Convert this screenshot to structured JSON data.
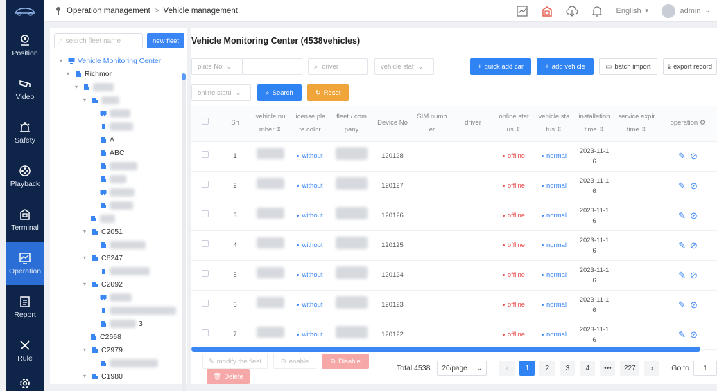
{
  "sidebar": {
    "items": [
      {
        "label": "Position",
        "icon": "position-icon"
      },
      {
        "label": "Video",
        "icon": "video-icon"
      },
      {
        "label": "Safety",
        "icon": "safety-icon"
      },
      {
        "label": "Playback",
        "icon": "playback-icon"
      },
      {
        "label": "Terminal",
        "icon": "terminal-icon"
      },
      {
        "label": "Operation",
        "icon": "operation-icon",
        "active": true
      },
      {
        "label": "Report",
        "icon": "report-icon"
      },
      {
        "label": "Rule",
        "icon": "rule-icon"
      }
    ]
  },
  "topbar": {
    "crumb_root": "Operation management",
    "crumb_sep": ">",
    "crumb_current": "Vehicle management",
    "language": "English",
    "user": "admin"
  },
  "tree": {
    "search_placeholder": "search fleet name",
    "new_fleet": "new fleet",
    "root": "Vehicle Monitoring Center",
    "richmor": "Richmor",
    "a": "A",
    "abc": "ABC",
    "c2051": "C2051",
    "c6247": "C6247",
    "c2092": "C2092",
    "trail_3": "3",
    "c2668": "C2668",
    "c2979": "C2979",
    "ellipsis": "...",
    "c1980": "C1980"
  },
  "main": {
    "title": "Vehicle Monitoring Center  (4538vehicles)",
    "filters": {
      "plate": "plate No",
      "driver_placeholder": "driver",
      "vehicle_status": "vehicle stat",
      "online_status": "online statu"
    },
    "buttons": {
      "quick_add": "quick add car",
      "add_vehicle": "add vehicle",
      "batch_import": "batch import",
      "export": "export record",
      "search": "Search",
      "reset": "Reset"
    },
    "columns": {
      "sn": "Sn",
      "vehicle_no_1": "vehicle nu",
      "vehicle_no_2": "mber",
      "plate_color_1": "license pla",
      "plate_color_2": "te color",
      "fleet_1": "fleet / com",
      "fleet_2": "pany",
      "device": "Device No",
      "sim_1": "SIM numb",
      "sim_2": "er",
      "driver": "driver",
      "online_1": "online stat",
      "online_2": "us",
      "vstatus_1": "vehicle sta",
      "vstatus_2": "tus",
      "install_1": "installation",
      "install_2": "time",
      "expire_1": "service expir",
      "expire_2": "time",
      "operation": "operation"
    },
    "rows": [
      {
        "sn": "1",
        "color": "without",
        "device": "120128",
        "online": "offline",
        "status": "normal",
        "install_1": "2023-11-1",
        "install_2": "6"
      },
      {
        "sn": "2",
        "color": "without",
        "device": "120127",
        "online": "offline",
        "status": "normal",
        "install_1": "2023-11-1",
        "install_2": "6"
      },
      {
        "sn": "3",
        "color": "without",
        "device": "120126",
        "online": "offline",
        "status": "normal",
        "install_1": "2023-11-1",
        "install_2": "6"
      },
      {
        "sn": "4",
        "color": "without",
        "device": "120125",
        "online": "offline",
        "status": "normal",
        "install_1": "2023-11-1",
        "install_2": "6"
      },
      {
        "sn": "5",
        "color": "without",
        "device": "120124",
        "online": "offline",
        "status": "normal",
        "install_1": "2023-11-1",
        "install_2": "6"
      },
      {
        "sn": "6",
        "color": "without",
        "device": "120123",
        "online": "offline",
        "status": "normal",
        "install_1": "2023-11-1",
        "install_2": "6"
      },
      {
        "sn": "7",
        "color": "without",
        "device": "120122",
        "online": "offline",
        "status": "normal",
        "install_1": "2023-11-1",
        "install_2": "6"
      }
    ],
    "actions": {
      "modify": "modify the fleet",
      "enable": "enable",
      "disable": "Disable",
      "delete": "Delete"
    },
    "pagination": {
      "total": "Total 4538",
      "page_size": "20/page",
      "pages": [
        "1",
        "2",
        "3",
        "4"
      ],
      "more": "•••",
      "last": "227",
      "goto": "Go to",
      "goto_value": "1"
    }
  },
  "colors": {
    "sidebar": "#0e2448",
    "accent": "#2f83f2",
    "orange": "#f0a53b",
    "danger": "#e84d4d"
  }
}
